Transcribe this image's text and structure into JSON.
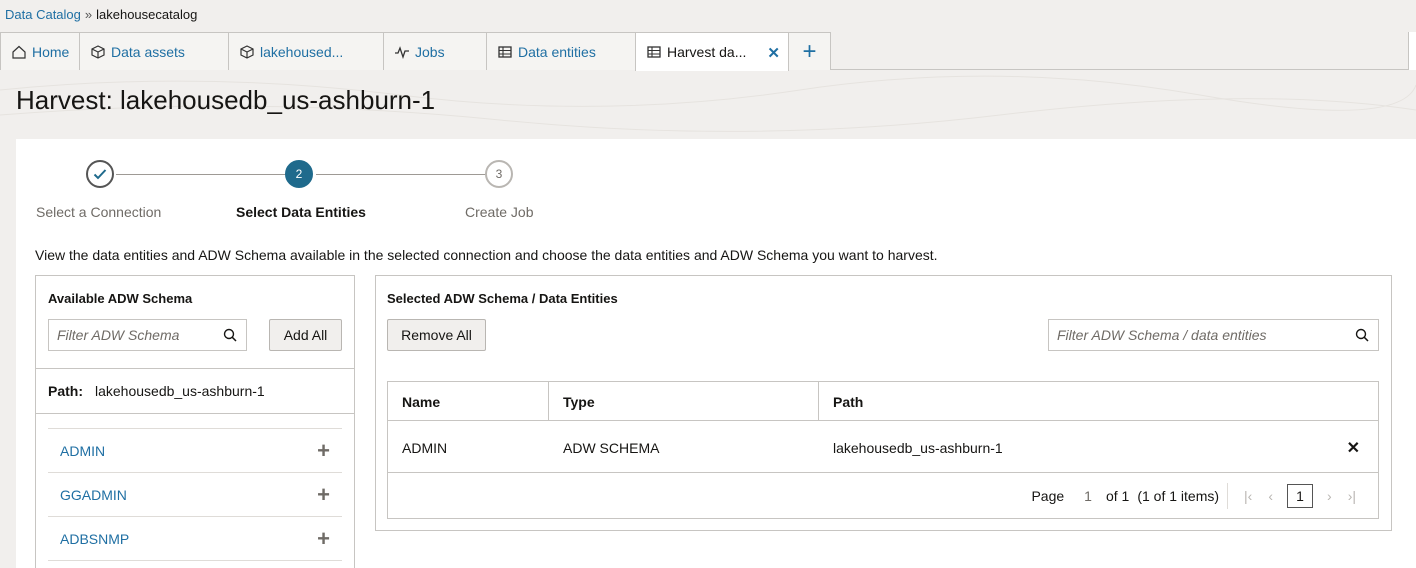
{
  "breadcrumb": {
    "root": "Data Catalog",
    "separator": "»",
    "current": "lakehousecatalog"
  },
  "tabs": [
    {
      "label": "Home",
      "icon": "home-icon"
    },
    {
      "label": "Data assets",
      "icon": "cube-icon"
    },
    {
      "label": "lakehoused...",
      "icon": "cube-icon"
    },
    {
      "label": "Jobs",
      "icon": "activity-icon"
    },
    {
      "label": "Data entities",
      "icon": "table-icon"
    },
    {
      "label": "Harvest da...",
      "icon": "table-icon",
      "active": true
    }
  ],
  "page": {
    "title": "Harvest: lakehousedb_us-ashburn-1"
  },
  "stepper": {
    "steps": [
      {
        "number": "1",
        "label": "Select a Connection",
        "state": "done"
      },
      {
        "number": "2",
        "label": "Select Data Entities",
        "state": "current"
      },
      {
        "number": "3",
        "label": "Create Job",
        "state": "future"
      }
    ]
  },
  "description": "View the data entities and ADW Schema available in the selected connection and choose the data entities and ADW Schema you want to harvest.",
  "available": {
    "title": "Available ADW Schema",
    "filter_placeholder": "Filter ADW Schema",
    "add_all_label": "Add All",
    "path_label": "Path:",
    "path_value": "lakehousedb_us-ashburn-1",
    "items": [
      "ADMIN",
      "GGADMIN",
      "ADBSNMP"
    ]
  },
  "selected": {
    "title": "Selected ADW Schema / Data Entities",
    "remove_all_label": "Remove All",
    "filter_placeholder": "Filter ADW Schema / data entities",
    "columns": [
      "Name",
      "Type",
      "Path"
    ],
    "rows": [
      {
        "name": "ADMIN",
        "type": "ADW SCHEMA",
        "path": "lakehousedb_us-ashburn-1"
      }
    ],
    "pager": {
      "page_label": "Page",
      "page_num": "1",
      "of_label": "of 1",
      "items_label": "(1 of 1 items)",
      "current_page": "1"
    }
  },
  "colors": {
    "link": "#1f6fa3",
    "step_current": "#1f6a8c",
    "background": "#f1efed"
  }
}
